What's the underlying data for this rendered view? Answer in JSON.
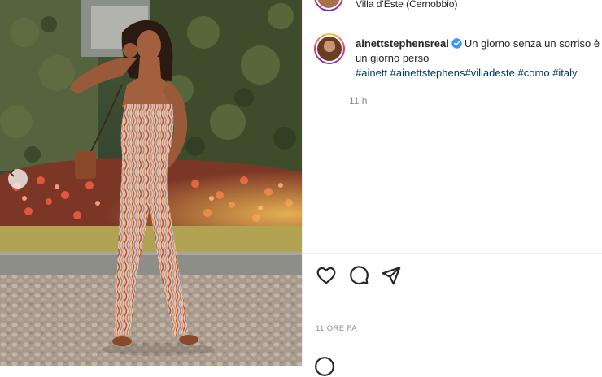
{
  "post": {
    "location": "Villa d'Este (Cernobbio)",
    "username": "ainettstephensreal",
    "caption_text": "Un giorno senza un sorriso è un giorno perso",
    "hashtags": [
      "#ainett",
      "#ainettstephens",
      "#villadeste",
      "#como",
      "#italy"
    ],
    "caption_time": "11 h",
    "posted_time": "11 ORE FA"
  },
  "icons": {
    "prev": "chevron-left-icon",
    "like": "heart-icon",
    "comment": "comment-icon",
    "share": "paper-plane-icon",
    "verified": "verified-badge-icon"
  },
  "colors": {
    "link": "#00376b",
    "text": "#262626",
    "muted": "#8e8e8e",
    "verified": "#3897f0"
  }
}
